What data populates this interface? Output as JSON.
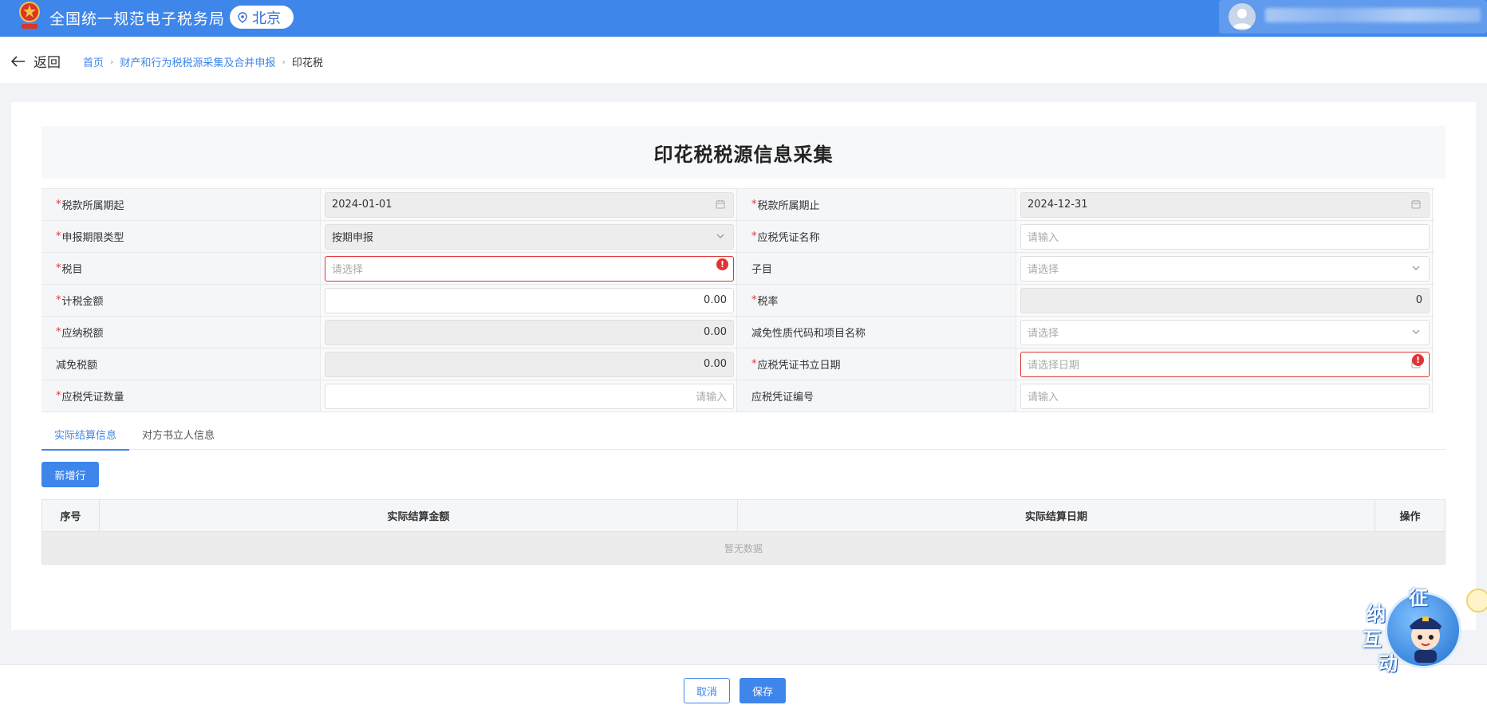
{
  "header": {
    "app_title": "全国统一规范电子税务局",
    "region": "北京"
  },
  "nav": {
    "back_label": "返回",
    "breadcrumb": [
      "首页",
      "财产和行为税税源采集及合并申报",
      "印花税"
    ]
  },
  "form": {
    "title": "印花税税源信息采集",
    "rows": [
      {
        "left": {
          "label": "税款所属期起",
          "required": true,
          "value": "2024-01-01",
          "placeholder": "",
          "kind": "date",
          "disabled": true
        },
        "right": {
          "label": "税款所属期止",
          "required": true,
          "value": "2024-12-31",
          "placeholder": "",
          "kind": "date",
          "disabled": true
        }
      },
      {
        "left": {
          "label": "申报期限类型",
          "required": true,
          "value": "按期申报",
          "placeholder": "",
          "kind": "select",
          "disabled": true
        },
        "right": {
          "label": "应税凭证名称",
          "required": true,
          "value": "",
          "placeholder": "请输入",
          "kind": "text"
        }
      },
      {
        "left": {
          "label": "税目",
          "required": true,
          "value": "",
          "placeholder": "请选择",
          "kind": "select-error",
          "error": true
        },
        "right": {
          "label": "子目",
          "required": false,
          "value": "",
          "placeholder": "请选择",
          "kind": "select"
        }
      },
      {
        "left": {
          "label": "计税金额",
          "required": true,
          "value": "0.00",
          "placeholder": "",
          "kind": "number"
        },
        "right": {
          "label": "税率",
          "required": true,
          "value": "0",
          "placeholder": "",
          "kind": "number",
          "disabled": true
        }
      },
      {
        "left": {
          "label": "应纳税额",
          "required": true,
          "value": "0.00",
          "placeholder": "",
          "kind": "number",
          "disabled": true
        },
        "right": {
          "label": "减免性质代码和项目名称",
          "required": false,
          "value": "",
          "placeholder": "请选择",
          "kind": "select"
        }
      },
      {
        "left": {
          "label": "减免税额",
          "required": false,
          "value": "0.00",
          "placeholder": "",
          "kind": "number",
          "disabled": true
        },
        "right": {
          "label": "应税凭证书立日期",
          "required": true,
          "value": "",
          "placeholder": "请选择日期",
          "kind": "date",
          "error": true
        }
      },
      {
        "left": {
          "label": "应税凭证数量",
          "required": true,
          "value": "",
          "placeholder": "请输入",
          "kind": "number"
        },
        "right": {
          "label": "应税凭证编号",
          "required": false,
          "value": "",
          "placeholder": "请输入",
          "kind": "text"
        }
      }
    ]
  },
  "tabs": [
    {
      "label": "实际结算信息",
      "active": true
    },
    {
      "label": "对方书立人信息",
      "active": false
    }
  ],
  "table": {
    "add_row_label": "新增行",
    "columns": [
      "序号",
      "实际结算金额",
      "实际结算日期",
      "操作"
    ],
    "empty_text": "暂无数据"
  },
  "footer": {
    "cancel_label": "取消",
    "save_label": "保存"
  },
  "assistant": {
    "chars": [
      "征",
      "纳",
      "互",
      "动"
    ]
  },
  "colors": {
    "primary": "#3f86ea",
    "error": "#e03434"
  }
}
